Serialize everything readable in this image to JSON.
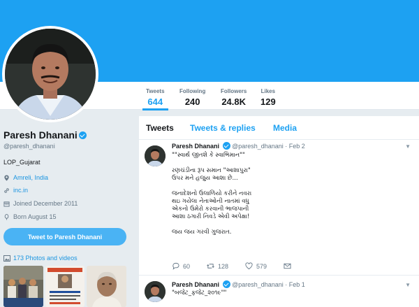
{
  "profile": {
    "name": "Paresh Dhanani",
    "handle": "@paresh_dhanani",
    "bio": "LOP_Gujarat",
    "location": "Amreli, India",
    "website": "inc.in",
    "joined": "Joined December 2011",
    "born": "Born August 15",
    "tweet_to": "Tweet to Paresh Dhanani",
    "photos_videos": "173 Photos and videos"
  },
  "stats": [
    {
      "label": "Tweets",
      "value": "644"
    },
    {
      "label": "Following",
      "value": "240"
    },
    {
      "label": "Followers",
      "value": "24.8K"
    },
    {
      "label": "Likes",
      "value": "129"
    }
  ],
  "tabs": [
    "Tweets",
    "Tweets & replies",
    "Media"
  ],
  "tweets": [
    {
      "name": "Paresh Dhanani",
      "handle": "@paresh_dhanani",
      "date": "· Feb 2",
      "text": "\"\"સ્વાર્થ જીતશે કે સ્વાભિમાન\"\"\n\nરણચંડીના રૂપ સમાન \"આશાપુરા\"\nઉપર મને હજુય આશા છે...\n\nજનાદેશનો ઉલાળિયો કરીને નવરા\nથઇ ગયેલા નેતાઓની નાતમાં વધુ\nએકનો ઉમેરો કરવાની ભાજપાની\nઆશા ઠગારી નિવડે એવી અપેક્ષા!\n\nજય જય ગરવી ગુજરાત.",
      "replies": "60",
      "retweets": "128",
      "likes": "579"
    },
    {
      "name": "Paresh Dhanani",
      "handle": "@paresh_dhanani",
      "date": "· Feb 1",
      "text": "\"બજેટ_ફજેટ_૨૦૧૯\"\"",
      "replies": "",
      "retweets": "",
      "likes": ""
    }
  ],
  "colors": {
    "brand": "#1da1f2",
    "background": "#e6ecf0",
    "text": "#14171a",
    "muted": "#657786"
  },
  "icons": [
    "location-icon",
    "link-icon",
    "calendar-icon",
    "balloon-icon",
    "photo-icon",
    "verified-icon",
    "reply-icon",
    "retweet-icon",
    "like-icon",
    "dm-icon",
    "caret-down-icon"
  ]
}
